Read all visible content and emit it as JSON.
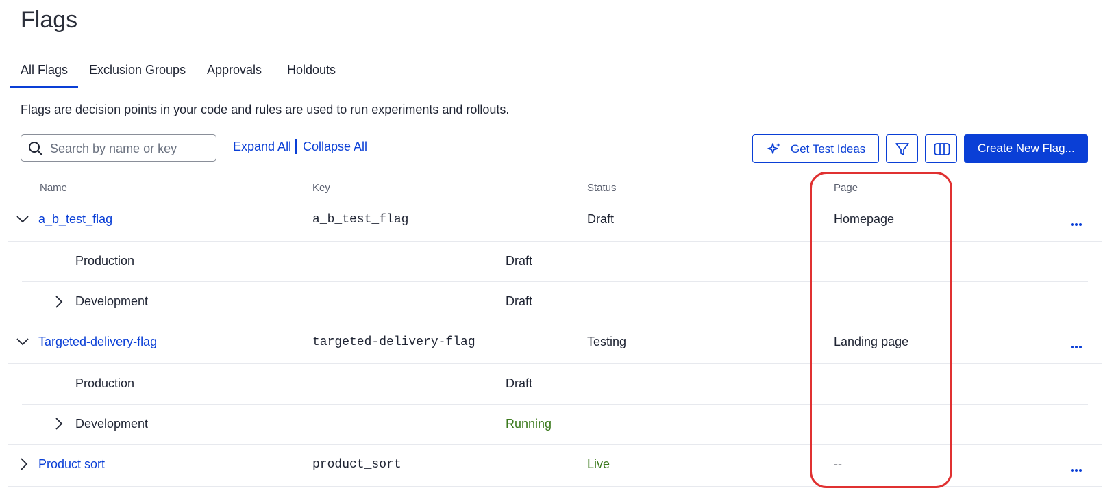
{
  "page": {
    "title": "Flags",
    "description": "Flags are decision points in your code and rules are used to run experiments and rollouts."
  },
  "tabs": [
    {
      "label": "All Flags",
      "active": true
    },
    {
      "label": "Exclusion Groups"
    },
    {
      "label": "Approvals"
    },
    {
      "label": "Holdouts"
    }
  ],
  "toolbar": {
    "search_placeholder": "Search by name or key",
    "expand_all": "Expand All",
    "collapse_all": "Collapse All",
    "get_test_ideas": "Get Test Ideas",
    "create_new_flag": "Create New Flag..."
  },
  "table": {
    "columns": [
      "Name",
      "Key",
      "Status",
      "Page"
    ],
    "flags": [
      {
        "name": "a_b_test_flag",
        "key": "a_b_test_flag",
        "status": "Draft",
        "page": "Homepage",
        "expanded": true,
        "environments": [
          {
            "name": "Production",
            "status": "Draft"
          },
          {
            "name": "Development",
            "status": "Draft"
          }
        ]
      },
      {
        "name": "Targeted-delivery-flag",
        "key": "targeted-delivery-flag",
        "status": "Testing",
        "page": "Landing page",
        "expanded": true,
        "environments": [
          {
            "name": "Production",
            "status": "Draft"
          },
          {
            "name": "Development",
            "status": "Running"
          }
        ]
      },
      {
        "name": "Product sort",
        "key": "product_sort",
        "status": "Live",
        "page": "--",
        "expanded": false
      }
    ]
  },
  "colors": {
    "accent": "#0a3fd6",
    "status_green": "#3c7a1e",
    "highlight": "#e03131"
  }
}
